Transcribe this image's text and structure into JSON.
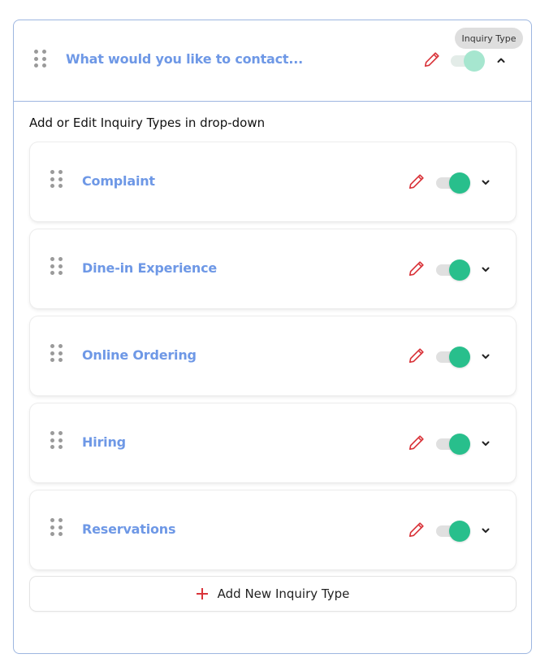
{
  "header": {
    "title": "What would you like to contact...",
    "tooltip": "Inquiry Type",
    "enabled": true,
    "expanded": true,
    "icons": [
      "drag-handle-icon",
      "pencil-icon",
      "toggle-switch",
      "chevron-up-icon"
    ]
  },
  "section_label": "Add or Edit Inquiry Types in drop-down",
  "items": [
    {
      "label": "Complaint",
      "enabled": true
    },
    {
      "label": "Dine-in Experience",
      "enabled": true
    },
    {
      "label": "Online Ordering",
      "enabled": true
    },
    {
      "label": "Hiring",
      "enabled": true
    },
    {
      "label": "Reservations",
      "enabled": true
    }
  ],
  "add_button": {
    "label": "Add New Inquiry Type",
    "icon": "plus-icon"
  },
  "colors": {
    "title_blue": "#6e98e6",
    "toggle_on": "#28bf8c",
    "toggle_on_light": "#a6e6cf",
    "edit_red": "#d9343a",
    "border_blue": "#9db6e0"
  }
}
